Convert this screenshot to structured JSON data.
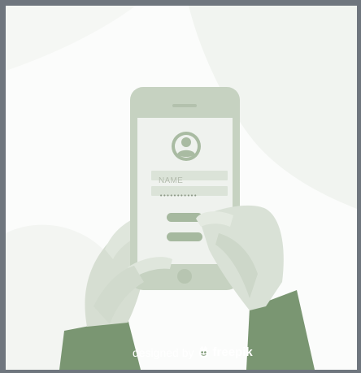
{
  "form": {
    "name_placeholder": "NAME",
    "password_placeholder": "•••••••••••"
  },
  "credit": {
    "text": "designed by",
    "brand": "freepik",
    "brand_icon": "freepik-logo-icon"
  },
  "colors": {
    "phone_body": "#c6d2c1",
    "phone_screen": "#eff2ee",
    "accent": "#a9bba2",
    "sleeve": "#7a9672",
    "hand": "#d9e1d6"
  }
}
